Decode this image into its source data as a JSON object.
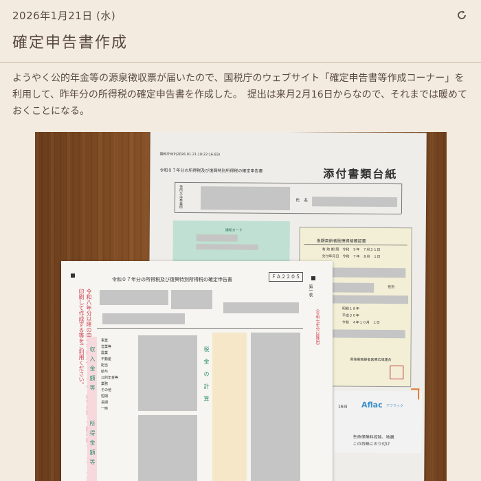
{
  "post": {
    "date": "2026年1月21日 (水)",
    "title": "確定申告書作成",
    "body": "ようやく公的年金等の源泉徴収票が届いたので、国税庁のウェブサイト「確定申告書等作成コーナー」を利用して、昨年分の所得税の確定申告書を作成した。　提出は来月2月16日からなので、それまでは暖めておくことになる。"
  },
  "photo": {
    "back_sheet": {
      "header_small": "国税庁WP(2026.01.21.10:22:16.83)",
      "subtitle": "令和０７年分の所得税及び復興特別所得税の確定申告書",
      "title": "添付書類台紙",
      "name_label": "氏　名",
      "address_label": "住所又は事業所",
      "card_label": "通知カード",
      "yellow_title": "後期高齢者医療資格確認書",
      "yellow_line1": "有 効 期 限　令和　９年　７月３１日",
      "yellow_line2": "交付年月日　令和　７年　８月　１日",
      "yellow_gender": "性別",
      "yellow_date1": "昭和１８年",
      "yellow_date2": "平成３０年",
      "yellow_date3": "令和　４年１０月　１日",
      "yellow_footer": "県後期高齢者医療広域連合",
      "aflac_brand": "Aflac",
      "aflac_sub": "アフラック",
      "aflac_num": "16日",
      "aflac_text1": "生命保険料控除、地震",
      "aflac_text2": "この台紙にのり付け"
    },
    "front_sheet": {
      "title": "令和０７年分の所得税及び復興特別所得税の確定申告書",
      "code": "ＦＡ２２０５",
      "section_first": "第一表",
      "section_note": "（令和七年分以降用）",
      "income_label": "収入金額等",
      "income_label2": "所得金額等",
      "tax_label": "税金の計算",
      "row_labels": [
        "事業",
        "営業等",
        "農業",
        "不動産",
        "配当",
        "給与",
        "公的年金等",
        "業務",
        "その他",
        "短期",
        "長期",
        "一時"
      ],
      "red_note": "令和八年分以降の申告書は送付しません。必要に応じて国税庁ホームページから印刷して作成する等をご利用ください。"
    }
  }
}
